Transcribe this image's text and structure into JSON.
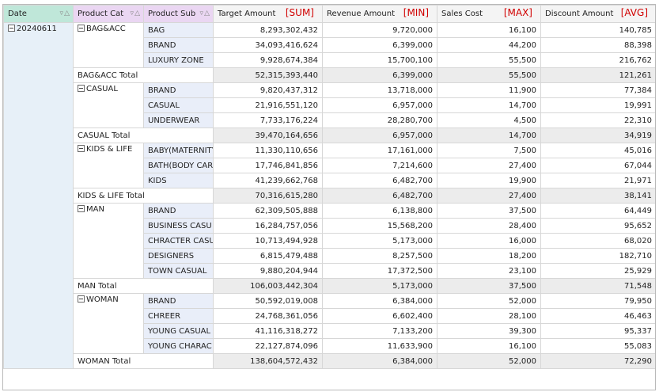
{
  "headers": {
    "date": "Date",
    "product_cat": "Product Cat",
    "product_sub": "Product Sub",
    "target": "Target Amount",
    "target_agg": "[SUM]",
    "revenue": "Revenue Amount",
    "revenue_agg": "[MIN]",
    "sales": "Sales Cost",
    "sales_agg": "[MAX]",
    "discount": "Discount Amount",
    "discount_agg": "[AVG]"
  },
  "date": "20240611",
  "groups": [
    {
      "name": "BAG&ACC",
      "rows": [
        {
          "sub": "BAG",
          "target": "8,293,302,432",
          "revenue": "9,720,000",
          "sales": "16,100",
          "discount": "140,785"
        },
        {
          "sub": "BRAND",
          "target": "34,093,416,624",
          "revenue": "6,399,000",
          "sales": "44,200",
          "discount": "88,398"
        },
        {
          "sub": "LUXURY ZONE",
          "target": "9,928,674,384",
          "revenue": "15,700,100",
          "sales": "55,500",
          "discount": "216,762"
        }
      ],
      "total": {
        "label": "BAG&ACC Total",
        "target": "52,315,393,440",
        "revenue": "6,399,000",
        "sales": "55,500",
        "discount": "121,261"
      }
    },
    {
      "name": "CASUAL",
      "rows": [
        {
          "sub": "BRAND",
          "target": "9,820,437,312",
          "revenue": "13,718,000",
          "sales": "11,900",
          "discount": "77,384"
        },
        {
          "sub": "CASUAL",
          "target": "21,916,551,120",
          "revenue": "6,957,000",
          "sales": "14,700",
          "discount": "19,991"
        },
        {
          "sub": "UNDERWEAR",
          "target": "7,733,176,224",
          "revenue": "28,280,700",
          "sales": "4,500",
          "discount": "22,310"
        }
      ],
      "total": {
        "label": "CASUAL Total",
        "target": "39,470,164,656",
        "revenue": "6,957,000",
        "sales": "14,700",
        "discount": "34,919"
      }
    },
    {
      "name": "KIDS & LIFE",
      "rows": [
        {
          "sub": "BABY(MATERNITY",
          "target": "11,330,110,656",
          "revenue": "17,161,000",
          "sales": "7,500",
          "discount": "45,016"
        },
        {
          "sub": "BATH(BODY CAR",
          "target": "17,746,841,856",
          "revenue": "7,214,600",
          "sales": "27,400",
          "discount": "67,044"
        },
        {
          "sub": "KIDS",
          "target": "41,239,662,768",
          "revenue": "6,482,700",
          "sales": "19,900",
          "discount": "21,971"
        }
      ],
      "total": {
        "label": "KIDS & LIFE Total",
        "target": "70,316,615,280",
        "revenue": "6,482,700",
        "sales": "27,400",
        "discount": "38,141"
      }
    },
    {
      "name": "MAN",
      "rows": [
        {
          "sub": "BRAND",
          "target": "62,309,505,888",
          "revenue": "6,138,800",
          "sales": "37,500",
          "discount": "64,449"
        },
        {
          "sub": "BUSINESS CASU",
          "target": "16,284,757,056",
          "revenue": "15,568,200",
          "sales": "28,400",
          "discount": "95,652"
        },
        {
          "sub": "CHRACTER CASU",
          "target": "10,713,494,928",
          "revenue": "5,173,000",
          "sales": "16,000",
          "discount": "68,020"
        },
        {
          "sub": "DESIGNERS",
          "target": "6,815,479,488",
          "revenue": "8,257,500",
          "sales": "18,200",
          "discount": "182,710"
        },
        {
          "sub": "TOWN CASUAL",
          "target": "9,880,204,944",
          "revenue": "17,372,500",
          "sales": "23,100",
          "discount": "25,929"
        }
      ],
      "total": {
        "label": "MAN Total",
        "target": "106,003,442,304",
        "revenue": "5,173,000",
        "sales": "37,500",
        "discount": "71,548"
      }
    },
    {
      "name": "WOMAN",
      "rows": [
        {
          "sub": "BRAND",
          "target": "50,592,019,008",
          "revenue": "6,384,000",
          "sales": "52,000",
          "discount": "79,950"
        },
        {
          "sub": "CHREER",
          "target": "24,768,361,056",
          "revenue": "6,602,400",
          "sales": "28,100",
          "discount": "46,463"
        },
        {
          "sub": "YOUNG CASUAL",
          "target": "41,116,318,272",
          "revenue": "7,133,200",
          "sales": "39,300",
          "discount": "95,337"
        },
        {
          "sub": "YOUNG CHARAC",
          "target": "22,127,874,096",
          "revenue": "11,633,900",
          "sales": "16,100",
          "discount": "55,083"
        }
      ],
      "total": {
        "label": "WOMAN Total",
        "target": "138,604,572,432",
        "revenue": "6,384,000",
        "sales": "52,000",
        "discount": "72,290"
      }
    }
  ]
}
